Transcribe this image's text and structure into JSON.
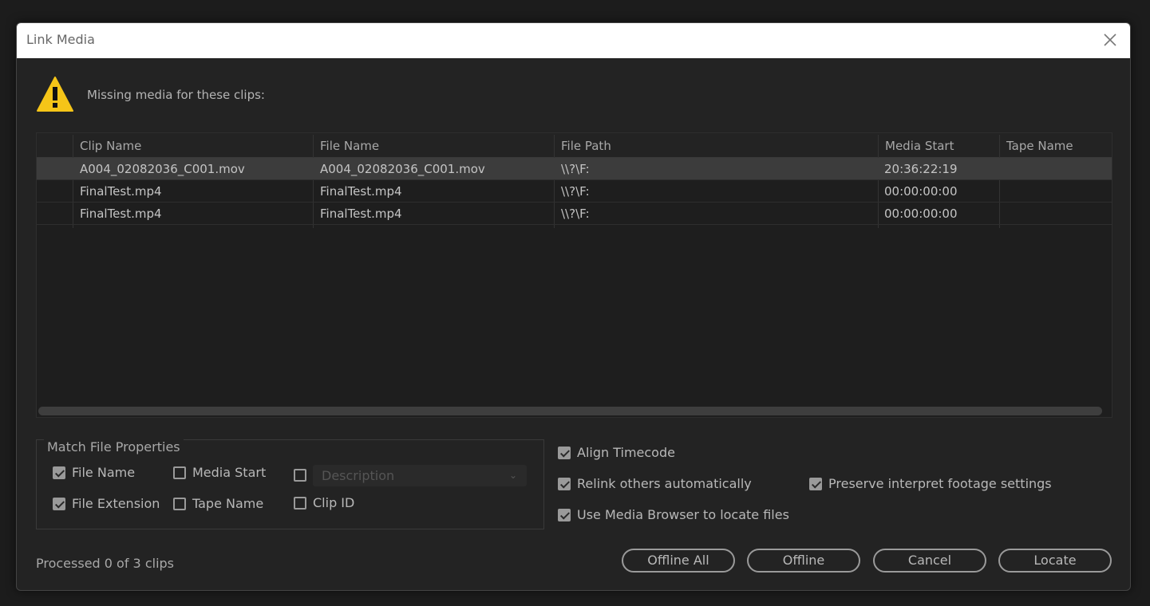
{
  "dialog": {
    "title": "Link Media"
  },
  "warning": {
    "message": "Missing media for these clips:"
  },
  "table": {
    "columns": [
      "Clip Name",
      "File Name",
      "File Path",
      "Media Start",
      "Tape Name"
    ],
    "rows": [
      {
        "clip_name": "A004_02082036_C001.mov",
        "file_name": "A004_02082036_C001.mov",
        "file_path": "\\\\?\\F:",
        "media_start": "20:36:22:19",
        "tape_name": ""
      },
      {
        "clip_name": "FinalTest.mp4",
        "file_name": "FinalTest.mp4",
        "file_path": "\\\\?\\F:",
        "media_start": "00:00:00:00",
        "tape_name": ""
      },
      {
        "clip_name": "FinalTest.mp4",
        "file_name": "FinalTest.mp4",
        "file_path": "\\\\?\\F:",
        "media_start": "00:00:00:00",
        "tape_name": ""
      }
    ]
  },
  "match_file_properties": {
    "legend": "Match File Properties",
    "file_name": {
      "label": "File Name",
      "checked": true
    },
    "file_extension": {
      "label": "File Extension",
      "checked": true
    },
    "media_start": {
      "label": "Media Start",
      "checked": false
    },
    "tape_name": {
      "label": "Tape Name",
      "checked": false
    },
    "description": {
      "label": "Description",
      "checked": false
    },
    "clip_id": {
      "label": "Clip ID",
      "checked": false
    }
  },
  "options": {
    "align_timecode": {
      "label": "Align Timecode",
      "checked": true
    },
    "relink_others": {
      "label": "Relink others automatically",
      "checked": true
    },
    "preserve_interpret": {
      "label": "Preserve interpret footage settings",
      "checked": true
    },
    "use_media_browser": {
      "label": "Use Media Browser to locate files",
      "checked": true
    }
  },
  "status": "Processed 0 of 3 clips",
  "buttons": {
    "offline_all": "Offline All",
    "offline": "Offline",
    "cancel": "Cancel",
    "locate": "Locate"
  },
  "colors": {
    "warning_yellow": "#f5c518",
    "selected_row": "#3c3c3c",
    "dialog_bg": "#232323"
  }
}
